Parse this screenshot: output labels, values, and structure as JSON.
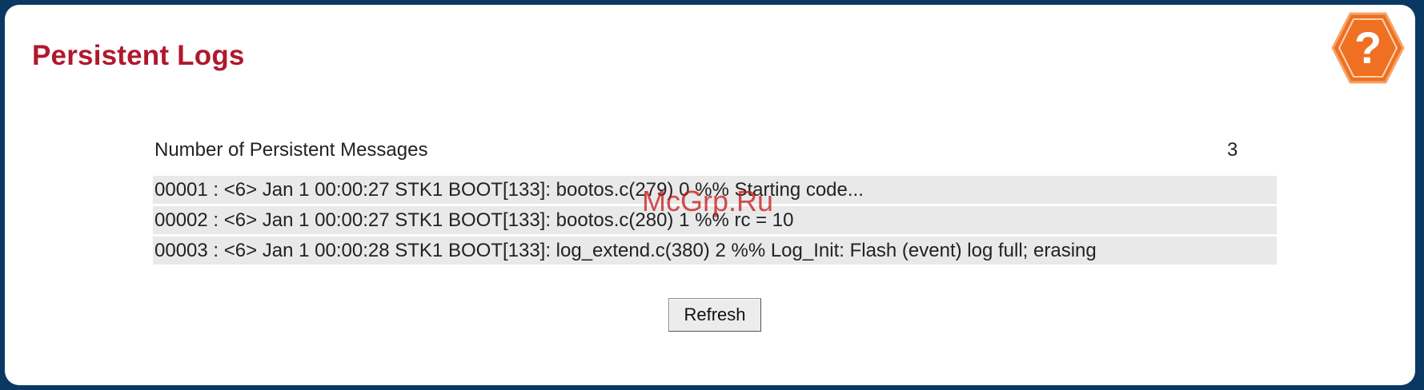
{
  "page": {
    "title": "Persistent Logs"
  },
  "help": {
    "icon": "help-question-icon",
    "glyph": "?",
    "color": "#ef7022"
  },
  "summary": {
    "label": "Number of Persistent Messages",
    "value": "3"
  },
  "logs": [
    "00001 : <6> Jan 1 00:00:27 STK1 BOOT[133]: bootos.c(279) 0 %% Starting code...",
    "00002 : <6> Jan 1 00:00:27 STK1 BOOT[133]: bootos.c(280) 1 %% rc = 10",
    "00003 : <6> Jan 1 00:00:28 STK1 BOOT[133]: log_extend.c(380) 2 %% Log_Init: Flash (event) log full; erasing"
  ],
  "actions": {
    "refresh_label": "Refresh"
  },
  "watermark": "McGrp.Ru",
  "colors": {
    "frame": "#0a3863",
    "title": "#b0182d",
    "row_background": "#e9e9e9"
  }
}
